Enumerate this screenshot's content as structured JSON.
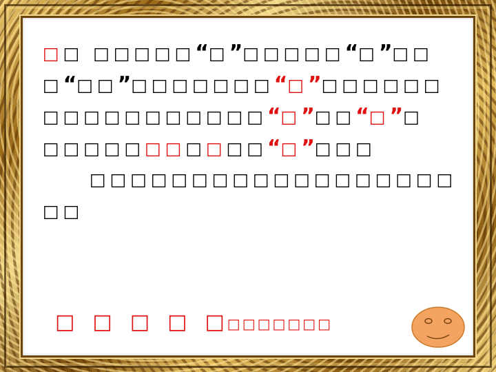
{
  "colors": {
    "accent": "#e01010",
    "text": "#000000",
    "smiley": "#f4a460"
  },
  "slide": {
    "lines": [
      [
        {
          "t": "□",
          "red": true
        },
        {
          "t": "□ □□□□□"
        },
        {
          "t": "“",
          "q": true
        },
        {
          "t": "□"
        },
        {
          "t": "”",
          "q": true
        },
        {
          "t": "□□□□□"
        },
        {
          "t": "“",
          "q": true
        },
        {
          "t": "□"
        },
        {
          "t": "”",
          "q": true
        },
        {
          "t": "□□"
        }
      ],
      [
        {
          "t": "□"
        },
        {
          "t": "“",
          "q": true
        },
        {
          "t": "□□"
        },
        {
          "t": "”",
          "q": true
        },
        {
          "t": "□□□□□□□"
        },
        {
          "t": "“",
          "q": true,
          "red": true
        },
        {
          "t": "□",
          "red": true
        },
        {
          "t": "”",
          "q": true,
          "red": true
        },
        {
          "t": "□□□□□□"
        }
      ],
      [
        {
          "t": "□□□□□□□□□□□"
        },
        {
          "t": "“",
          "q": true,
          "red": true
        },
        {
          "t": "□",
          "red": true
        },
        {
          "t": "”",
          "q": true,
          "red": true
        },
        {
          "t": "□□"
        },
        {
          "t": "“",
          "q": true,
          "red": true
        },
        {
          "t": "□",
          "red": true
        },
        {
          "t": "”",
          "q": true,
          "red": true
        },
        {
          "t": "□"
        }
      ],
      [
        {
          "t": "□□□□□"
        },
        {
          "t": "□□",
          "red": true
        },
        {
          "t": "□"
        },
        {
          "t": "□",
          "red": true
        },
        {
          "t": "□□"
        },
        {
          "t": "“",
          "q": true,
          "red": true
        },
        {
          "t": "□",
          "red": true
        },
        {
          "t": "”",
          "q": true,
          "red": true
        },
        {
          "t": "□□□"
        }
      ],
      [
        {
          "t": "□□□□□□□□□□□□□□□□□□"
        }
      ],
      [
        {
          "t": "□□"
        }
      ]
    ],
    "indent_lines": [
      4
    ],
    "bottom": {
      "big": [
        "□",
        "□",
        "□",
        "□",
        "□"
      ],
      "small": "□□□□□□□"
    }
  },
  "smiley": {
    "icon": "smiley-face-icon"
  }
}
